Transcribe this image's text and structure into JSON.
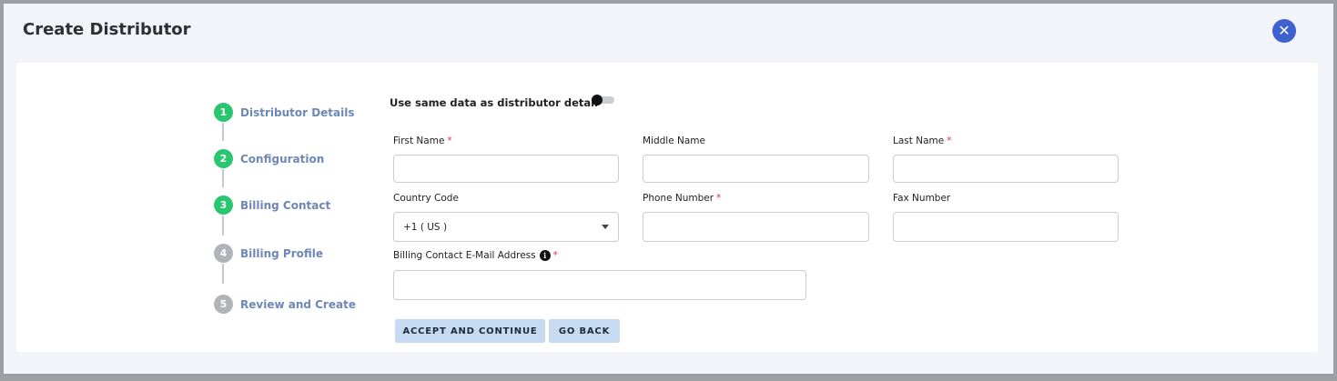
{
  "modal": {
    "title": "Create Distributor",
    "close_icon": "close-circle-icon"
  },
  "stepper": {
    "steps": [
      {
        "number": "1",
        "label": "Distributor Details",
        "state": "done"
      },
      {
        "number": "2",
        "label": "Configuration",
        "state": "done"
      },
      {
        "number": "3",
        "label": "Billing Contact",
        "state": "current"
      },
      {
        "number": "4",
        "label": "Billing Profile",
        "state": "todo"
      },
      {
        "number": "5",
        "label": "Review and Create",
        "state": "todo"
      }
    ]
  },
  "form": {
    "same_data_label": "Use same data as distributor detail",
    "same_data_enabled": false,
    "first_name": {
      "label": "First Name",
      "required": "*",
      "value": ""
    },
    "middle_name": {
      "label": "Middle Name",
      "value": ""
    },
    "last_name": {
      "label": "Last Name",
      "required": "*",
      "value": ""
    },
    "country_code": {
      "label": "Country Code",
      "value": "+1 ( US )"
    },
    "phone_number": {
      "label": "Phone Number",
      "required": "*",
      "value": ""
    },
    "fax_number": {
      "label": "Fax Number",
      "value": ""
    },
    "email": {
      "label": "Billing Contact E-Mail Address",
      "required": "*",
      "value": "",
      "info_icon": "info-icon"
    }
  },
  "actions": {
    "accept_label": "ACCEPT AND CONTINUE",
    "back_label": "GO BACK"
  },
  "colors": {
    "accent": "#3d62d0",
    "step_done": "#28c76f",
    "step_todo": "#b0b3b8",
    "button_bg": "#c6dbf1",
    "required": "#e53935"
  }
}
